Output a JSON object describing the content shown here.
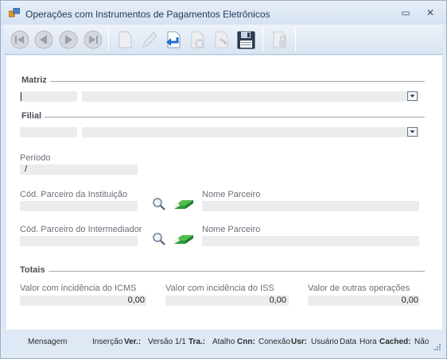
{
  "window": {
    "title": "Operações com Instrumentos de Pagamentos Eletrônicos",
    "minimize_glyph": "▭",
    "close_glyph": "✕"
  },
  "toolbar": {
    "buttons": [
      {
        "name": "first-record-button",
        "icon": "first-icon"
      },
      {
        "name": "previous-record-button",
        "icon": "previous-icon"
      },
      {
        "name": "next-record-button",
        "icon": "next-icon"
      },
      {
        "name": "last-record-button",
        "icon": "last-icon"
      },
      {
        "name": "new-button",
        "icon": "new-document-icon"
      },
      {
        "name": "edit-button",
        "icon": "edit-pencil-icon"
      },
      {
        "name": "undo-button",
        "icon": "undo-arrow-icon"
      },
      {
        "name": "delete-button",
        "icon": "delete-icon"
      },
      {
        "name": "cancel-button",
        "icon": "cancel-arrow-icon"
      },
      {
        "name": "save-button",
        "icon": "floppy-disk-icon"
      },
      {
        "name": "lock-button",
        "icon": "lock-icon"
      }
    ]
  },
  "form": {
    "matriz": {
      "title": "Matriz",
      "code": "",
      "name": ""
    },
    "filial": {
      "title": "Filial",
      "code": "",
      "name": ""
    },
    "periodo": {
      "label": "Período",
      "value": "/"
    },
    "parceiro_instituicao": {
      "label": "Cód. Parceiro da Instituição",
      "code": "",
      "name_label": "Nome Parceiro",
      "name": ""
    },
    "parceiro_intermediador": {
      "label": "Cód. Parceiro do Intermediador",
      "code": "",
      "name_label": "Nome Parceiro",
      "name": ""
    },
    "totais": {
      "title": "Totais",
      "icms_label": "Valor com incidência do ICMS",
      "icms_value": "0,00",
      "iss_label": "Valor com incidência do ISS",
      "iss_value": "0,00",
      "outras_label": "Valor de outras operações",
      "outras_value": "0,00"
    }
  },
  "status": {
    "mensagem": "Mensagem",
    "insercao": "Inserção",
    "ver_label": "Ver.:",
    "ver_value": "Versão 1/1",
    "tra_label": "Tra.:",
    "tra_value": "Atalho",
    "cnn_label": "Cnn:",
    "cnn_value": "Conexão",
    "usr_label": "Usr:",
    "usr_value": "Usuário",
    "data": "Data",
    "hora": "Hora",
    "cached_label": "Cached:",
    "cached_value": "Não"
  },
  "colors": {
    "window_bg": "#dfe9f5",
    "field_bg": "#ececec",
    "title_text": "#1e395b",
    "green_icon": "#2e9a3a"
  }
}
